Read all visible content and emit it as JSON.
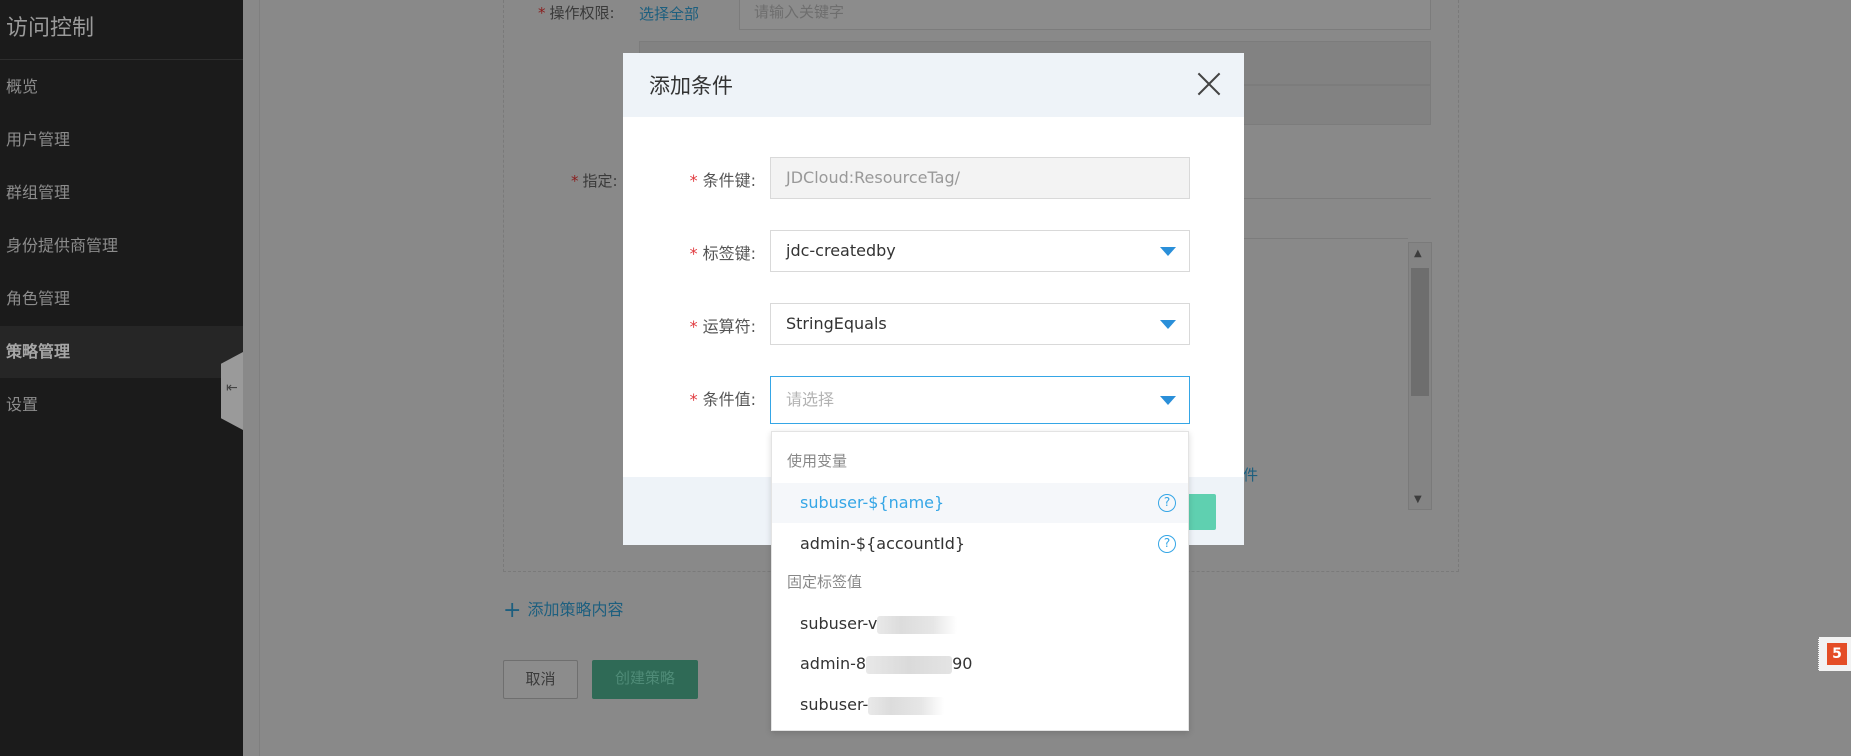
{
  "sidebar": {
    "title": "访问控制",
    "items": [
      {
        "label": "概览"
      },
      {
        "label": "用户管理"
      },
      {
        "label": "群组管理"
      },
      {
        "label": "身份提供商管理"
      },
      {
        "label": "角色管理"
      },
      {
        "label": "策略管理",
        "active": true
      },
      {
        "label": "设置"
      }
    ]
  },
  "background_form": {
    "operation_label": "操作权限:",
    "select_all": "选择全部",
    "keyword_placeholder": "请输入关键字",
    "specify_label": "指定:",
    "add_condition_fragment": "件",
    "add_policy_content": "添加策略内容",
    "cancel": "取消",
    "create_policy": "创建策略"
  },
  "modal": {
    "title": "添加条件",
    "fields": {
      "condition_key": {
        "label": "条件键:",
        "value": "JDCloud:ResourceTag/"
      },
      "tag_key": {
        "label": "标签键:",
        "value": "jdc-createdby"
      },
      "operator": {
        "label": "运算符:",
        "value": "StringEquals"
      },
      "condition_value": {
        "label": "条件值:",
        "placeholder": "请选择"
      }
    }
  },
  "dropdown": {
    "group_variables": "使用变量",
    "variables": [
      {
        "label": "subuser-${name}",
        "highlighted": true
      },
      {
        "label": "admin-${accountId}"
      }
    ],
    "group_fixed": "固定标签值",
    "fixed_values": [
      {
        "prefix": "subuser-v",
        "suffix": ""
      },
      {
        "prefix": "admin-8",
        "suffix": "90"
      },
      {
        "prefix": "subuser-",
        "suffix": ""
      }
    ]
  },
  "colors": {
    "accent": "#35a6e6",
    "required": "#e0393e",
    "primary_button": "#5fd0b0"
  }
}
